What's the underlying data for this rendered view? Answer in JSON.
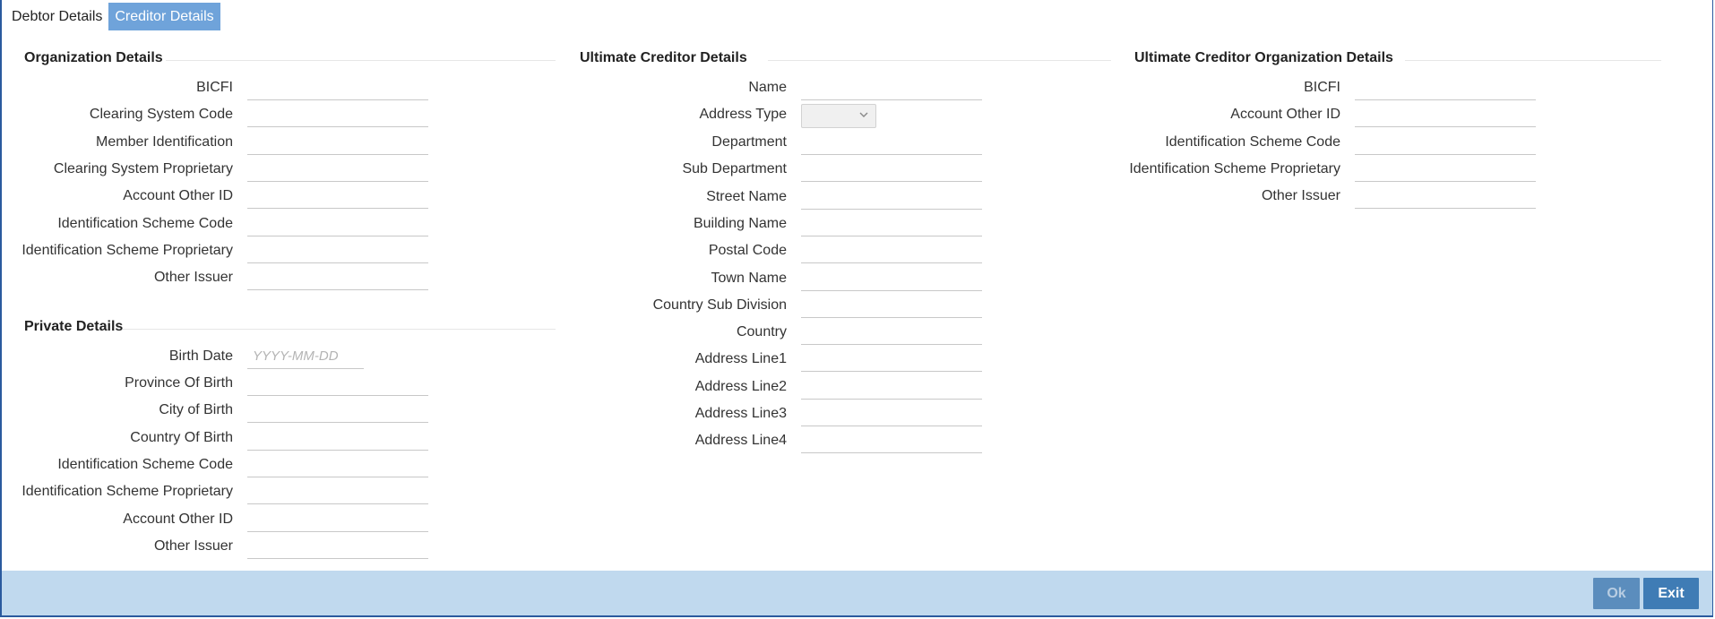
{
  "tabs": [
    {
      "label": "Debtor Details",
      "active": false
    },
    {
      "label": "Creditor Details",
      "active": true
    }
  ],
  "organization": {
    "title": "Organization Details",
    "fields": [
      "BICFI",
      "Clearing System Code",
      "Member Identification",
      "Clearing System Proprietary",
      "Account Other ID",
      "Identification Scheme Code",
      "Identification Scheme Proprietary",
      "Other Issuer"
    ]
  },
  "private": {
    "title": "Private Details",
    "birth_date_label": "Birth Date",
    "birth_date_placeholder": "YYYY-MM-DD",
    "fields": [
      "Province Of Birth",
      "City of Birth",
      "Country Of Birth",
      "Identification Scheme Code",
      "Identification Scheme Proprietary",
      "Account Other ID",
      "Other Issuer"
    ]
  },
  "ultimate_creditor": {
    "title": "Ultimate Creditor Details",
    "name_label": "Name",
    "address_type_label": "Address Type",
    "address_type_value": "",
    "fields": [
      "Department",
      "Sub Department",
      "Street Name",
      "Building Name",
      "Postal Code",
      "Town Name",
      "Country Sub Division",
      "Country",
      "Address Line1",
      "Address Line2",
      "Address Line3",
      "Address Line4"
    ]
  },
  "ultimate_creditor_org": {
    "title": "Ultimate Creditor Organization Details",
    "fields": [
      "BICFI",
      "Account Other ID",
      "Identification Scheme Code",
      "Identification Scheme Proprietary",
      "Other Issuer"
    ]
  },
  "footer": {
    "ok_label": "Ok",
    "exit_label": "Exit"
  },
  "colors": {
    "tab_active": "#6fa3da",
    "footer_bg": "#c0d9ee",
    "button_bg": "#3f7cb5"
  },
  "icons": {
    "address_type_dropdown": "chevron-down-icon"
  }
}
